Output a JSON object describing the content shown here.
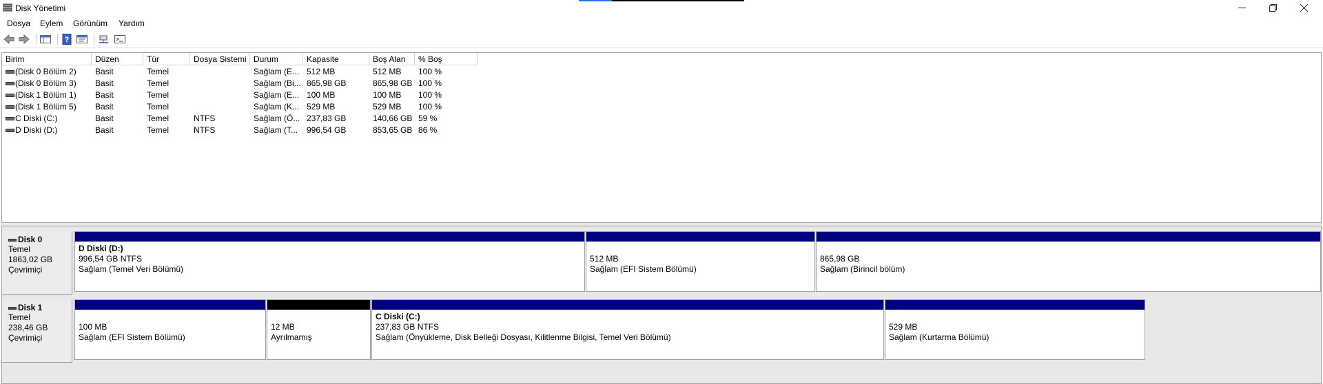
{
  "window": {
    "title": "Disk Yönetimi",
    "minimize_icon": "minimize-icon",
    "restore_icon": "restore-icon",
    "close_icon": "close-icon"
  },
  "menu": [
    "Dosya",
    "Eylem",
    "Görünüm",
    "Yardım"
  ],
  "toolbar_icons": [
    "back-arrow-icon",
    "forward-arrow-icon",
    "console-tree-icon",
    "help-icon",
    "properties-icon",
    "connect-icon",
    "console-icon"
  ],
  "volume_table": {
    "columns": [
      "Birim",
      "Düzen",
      "Tür",
      "Dosya Sistemi",
      "Durum",
      "Kapasite",
      "Boş Alan",
      "% Boş"
    ],
    "rows": [
      [
        "(Disk 0 Bölüm 2)",
        "Basit",
        "Temel",
        "",
        "Sağlam (E...",
        "512 MB",
        "512 MB",
        "100 %"
      ],
      [
        "(Disk 0 Bölüm 3)",
        "Basit",
        "Temel",
        "",
        "Sağlam (Bi...",
        "865,98 GB",
        "865,98 GB",
        "100 %"
      ],
      [
        "(Disk 1 Bölüm 1)",
        "Basit",
        "Temel",
        "",
        "Sağlam (E...",
        "100 MB",
        "100 MB",
        "100 %"
      ],
      [
        "(Disk 1 Bölüm 5)",
        "Basit",
        "Temel",
        "",
        "Sağlam (K...",
        "529 MB",
        "529 MB",
        "100 %"
      ],
      [
        "C Diski (C:)",
        "Basit",
        "Temel",
        "NTFS",
        "Sağlam (Ö...",
        "237,83 GB",
        "140,66 GB",
        "59 %"
      ],
      [
        "D Diski (D:)",
        "Basit",
        "Temel",
        "NTFS",
        "Sağlam (T...",
        "996,54 GB",
        "853,65 GB",
        "86 %"
      ]
    ]
  },
  "colors": {
    "primary_partition_bar": "#000080",
    "unallocated_bar": "#000000"
  },
  "disks": [
    {
      "name": "Disk 0",
      "type": "Temel",
      "size": "1863,02 GB",
      "status": "Çevrimiçi",
      "partitions": [
        {
          "name": "D Diski  (D:)",
          "size": "996,54 GB NTFS",
          "status": "Sağlam (Temel Veri Bölümü)",
          "bar": "#000080"
        },
        {
          "name": "",
          "size": "512 MB",
          "status": "Sağlam (EFI Sistem Bölümü)",
          "bar": "#000080"
        },
        {
          "name": "",
          "size": "865,98 GB",
          "status": "Sağlam (Birincil bölüm)",
          "bar": "#000080"
        }
      ]
    },
    {
      "name": "Disk 1",
      "type": "Temel",
      "size": "238,46 GB",
      "status": "Çevrimiçi",
      "partitions": [
        {
          "name": "",
          "size": "100 MB",
          "status": "Sağlam (EFI Sistem Bölümü)",
          "bar": "#000080"
        },
        {
          "name": "",
          "size": "12 MB",
          "status": "Ayrılmamış",
          "bar": "#000000"
        },
        {
          "name": "C Diski  (C:)",
          "size": "237,83 GB NTFS",
          "status": "Sağlam (Önyükleme, Disk Belleği Dosyası, Kilitlenme Bilgisi, Temel Veri Bölümü)",
          "bar": "#000080"
        },
        {
          "name": "",
          "size": "529 MB",
          "status": "Sağlam (Kurtarma Bölümü)",
          "bar": "#000080"
        }
      ]
    }
  ]
}
